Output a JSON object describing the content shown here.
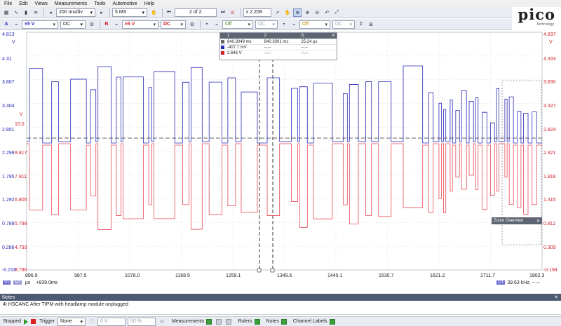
{
  "menu": [
    "File",
    "Edit",
    "Views",
    "Measurements",
    "Tools",
    "Automotive",
    "Help"
  ],
  "logo": {
    "text": "pico",
    "sub": "Technology"
  },
  "toolbar1": {
    "timebase": "200 ms/div",
    "samples": "5 MS",
    "buffer": "2 of 2",
    "zoom": "x 2.209"
  },
  "toolbar2": {
    "chA": {
      "label": "A",
      "range": "±5 V",
      "coupling": "DC"
    },
    "chB": {
      "label": "B",
      "range": "±5 V",
      "coupling": "DC"
    },
    "trig": {
      "off1": "Off",
      "dc": "DC",
      "off2": "Off"
    }
  },
  "axes": {
    "left_top": "4.813",
    "left_unit": "V",
    "left_ticks": [
      "4.31",
      "3.807",
      "3.304",
      "2.801",
      "2.298",
      "1.795",
      "1.292",
      "0.789",
      "0.286",
      "-0.218"
    ],
    "left2_unit": "V",
    "left2_ticks": [
      "10.0",
      "8.817",
      "7.811",
      "6.805",
      "5.799",
      "4.793",
      "3.786"
    ],
    "right_top": "4.837",
    "right_unit": "V",
    "right_ticks": [
      "4.333",
      "3.830",
      "3.327",
      "2.824",
      "2.321",
      "1.818",
      "1.315",
      "0.812",
      "0.309",
      "-0.194"
    ],
    "x_ticks": [
      "896.9",
      "987.5",
      "1078.0",
      "1168.5",
      "1259.1",
      "1349.6",
      "1440.1",
      "1530.7",
      "1621.2",
      "1711.7",
      "1802.3"
    ]
  },
  "ruler_table": {
    "headers": [
      "1",
      "2",
      "Δ"
    ],
    "rows": [
      {
        "c1": "840.3049 ms",
        "c2": "840.3301 ms",
        "c3": "25.24 μs",
        "color": "#666666"
      },
      {
        "c1": "-407.7 mV",
        "c2": "--.--",
        "c3": "--.--",
        "color": "#2a2ab8"
      },
      {
        "c1": "2.646 V",
        "c2": "--.--",
        "c3": "--.--",
        "color": "#d0202a"
      }
    ]
  },
  "zoom_overview": "Zoom Overview",
  "bottom_axis": {
    "badge1": "V1",
    "badge2": "V2",
    "unit": "μs",
    "offset": "+839.0ms",
    "ref": "1/1",
    "freq": "39.63 kHz, --.--"
  },
  "notes": {
    "title": "Notes",
    "text": "4t HSCANC After TIPM with headlamp module unplugged"
  },
  "statusbar": {
    "state": "Stopped",
    "trigger": "Trigger",
    "trigger_mode": "None",
    "level": "0 V",
    "pre": "50 %",
    "measurements": "Measurements",
    "rulers": "Rulers",
    "notes": "Notes",
    "channel_labels": "Channel Labels"
  },
  "colors": {
    "chA": "#2a2ab8",
    "chB": "#e84b55",
    "accent": "#4c5a72"
  }
}
